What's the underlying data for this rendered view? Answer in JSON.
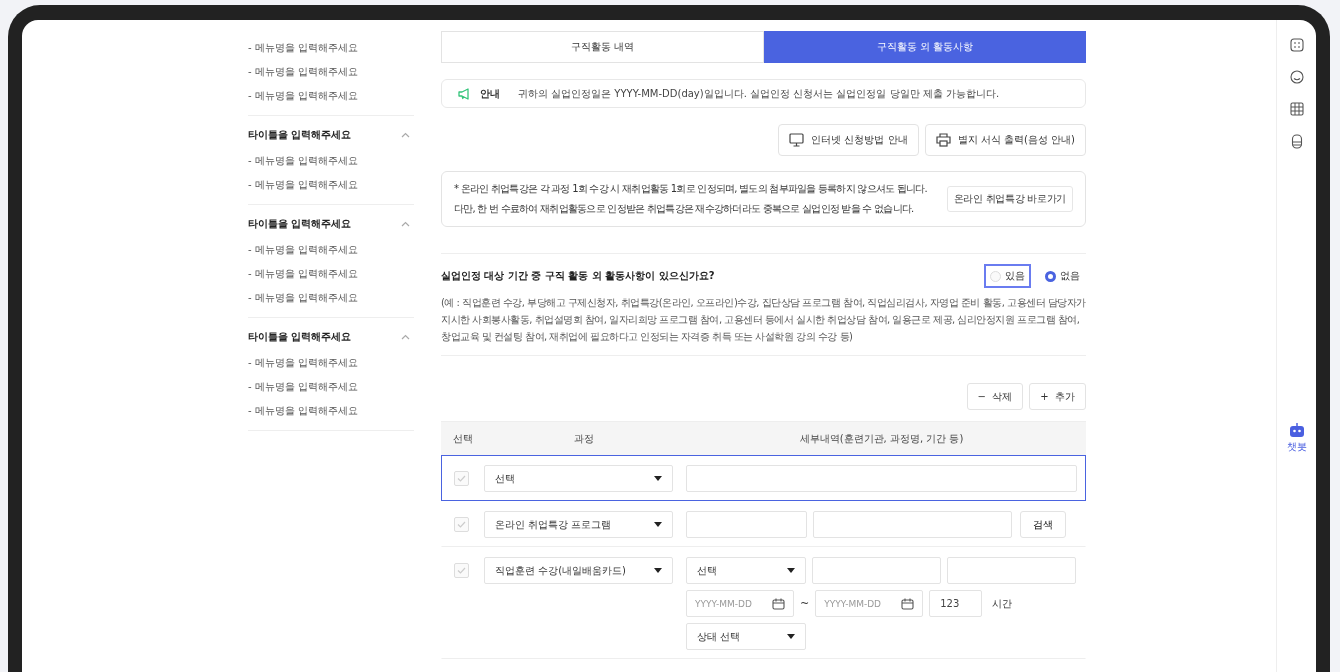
{
  "sidebar": {
    "groups": [
      {
        "items": [
          "- 메뉴명을 입력해주세요",
          "- 메뉴명을 입력해주세요",
          "- 메뉴명을 입력해주세요"
        ]
      },
      {
        "title": "타이틀을 입력해주세요",
        "expanded": true,
        "items": [
          "- 메뉴명을 입력해주세요",
          "- 메뉴명을 입력해주세요"
        ]
      },
      {
        "title": "타이틀을 입력해주세요",
        "expanded": true,
        "items": [
          "- 메뉴명을 입력해주세요",
          "- 메뉴명을 입력해주세요",
          "- 메뉴명을 입력해주세요"
        ]
      },
      {
        "title": "타이틀을 입력해주세요",
        "expanded": true,
        "items": [
          "- 메뉴명을 입력해주세요",
          "- 메뉴명을 입력해주세요",
          "- 메뉴명을 입력해주세요"
        ]
      }
    ]
  },
  "tabs": [
    {
      "label": "구직활동 내역",
      "selected": false
    },
    {
      "label": "구직활동 외 활동사항",
      "selected": true
    }
  ],
  "notice": {
    "label": "안내",
    "text": "귀하의 실업인정일은 YYYY-MM-DD(day)일입니다. 실업인정 신청서는 실업인정일 당일만 제출 가능합니다."
  },
  "action_buttons": [
    {
      "kind": "monitor",
      "label": "인터넷 신청방법 안내"
    },
    {
      "kind": "printer",
      "label": "별지 서식 출력(음성 안내)"
    }
  ],
  "info_box": {
    "lines": [
      "* 온라인 취업특강은 각 과정 1회 수강 시 재취업활동 1회로 인정되며, 별도의 첨부파일을 등록하지 않으셔도 됩니다.",
      "다만, 한 번 수료하여 재취업활동으로 인정받은 취업특강은 재수강하더라도 중복으로 실업인정 받을 수 없습니다."
    ],
    "link_button": "온라인 취업특강 바로가기"
  },
  "question": {
    "text": "실업인정 대상 기간 중 구직 활동 외 활동사항이 있으신가요?",
    "options": [
      {
        "label": "있음",
        "selected": false,
        "focused": true
      },
      {
        "label": "없음",
        "selected": true,
        "focused": false
      }
    ],
    "example": "(예 : 직업훈련 수강, 부당해고 구제신청자, 취업특강(온라인, 오프라인)수강, 집단상담 프로그램 참여, 직업심리검사, 자영업 준비 활동, 고용센터 담당자가 지시한 사회봉사활동, 취업설명회 참여, 일자리희망 프로그램 참여, 고용센터 등에서 실시한 취업상담 참여, 일용근로 제공, 심리안정지원 프로그램 참여, 창업교육 및 컨설팅 참여, 재취업에 필요하다고 인정되는 자격증 취득 또는 사설학원 강의 수강 등)"
  },
  "table_buttons": [
    {
      "icon": "−",
      "label": "삭제"
    },
    {
      "icon": "+",
      "label": "추가"
    }
  ],
  "table": {
    "columns": [
      "선택",
      "과정",
      "세부내역(훈련기관, 과정명, 기간 등)"
    ],
    "rows": [
      {
        "kind": "text",
        "selected": true,
        "checked": false,
        "course": "선택"
      },
      {
        "kind": "search",
        "selected": false,
        "checked": false,
        "course": "온라인 취업특강 프로그램",
        "button": "검색"
      },
      {
        "kind": "training",
        "selected": false,
        "checked": false,
        "course": "직업훈련 수강(내일배움카드)",
        "select": "선택",
        "date_from": "YYYY-MM-DD",
        "range_sign": "~",
        "date_to": "YYYY-MM-DD",
        "hours": "123",
        "unit": "시간",
        "status": "상태 선택"
      }
    ]
  },
  "rail": {
    "bot_label": "챗봇"
  }
}
